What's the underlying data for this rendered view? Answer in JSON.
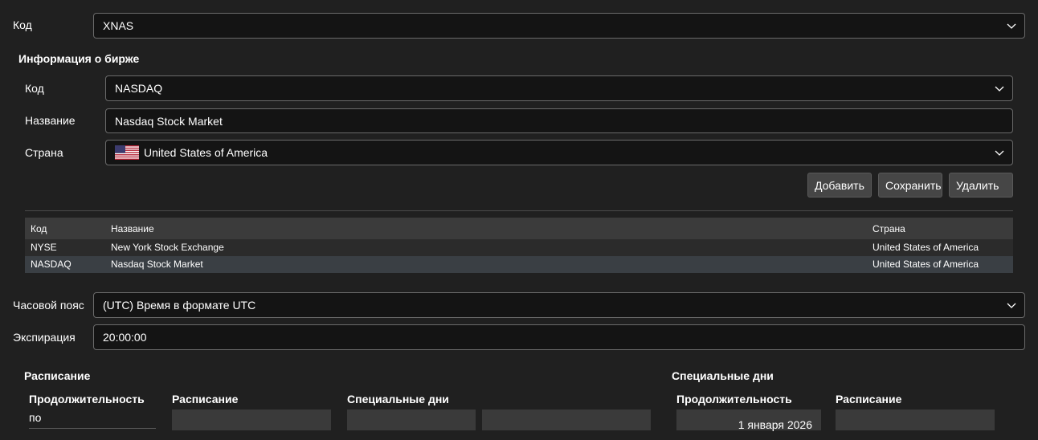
{
  "top": {
    "code_label": "Код",
    "code_value": "XNAS"
  },
  "exchange_info": {
    "title": "Информация о бирже",
    "code_label": "Код",
    "code_value": "NASDAQ",
    "name_label": "Название",
    "name_value": "Nasdaq Stock Market",
    "country_label": "Страна",
    "country_value": "United States of America",
    "country_flag": "us-flag",
    "buttons": {
      "add": "Добавить",
      "save": "Сохранить",
      "delete": "Удалить"
    },
    "table": {
      "columns": [
        "Код",
        "Название",
        "Страна"
      ],
      "rows": [
        {
          "code": "NYSE",
          "name": "New York Stock Exchange",
          "country": "United States of America",
          "selected": false
        },
        {
          "code": "NASDAQ",
          "name": "Nasdaq Stock Market",
          "country": "United States of America",
          "selected": true
        }
      ]
    }
  },
  "timezone": {
    "label": "Часовой пояс",
    "value": "(UTC) Время в формате UTC"
  },
  "expiration": {
    "label": "Экспирация",
    "value": "20:00:00"
  },
  "schedule": {
    "title": "Расписание",
    "col_duration": "Продолжительность",
    "col_schedule": "Расписание",
    "col_special_days": "Специальные дни",
    "duration_value": "по"
  },
  "special_days": {
    "title": "Специальные дни",
    "col_duration": "Продолжительность",
    "col_schedule": "Расписание",
    "duration_value": "1 января 2026"
  },
  "colors": {
    "background": "#202020",
    "field_bg": "#141414",
    "selected_row": "#3a3f44"
  }
}
